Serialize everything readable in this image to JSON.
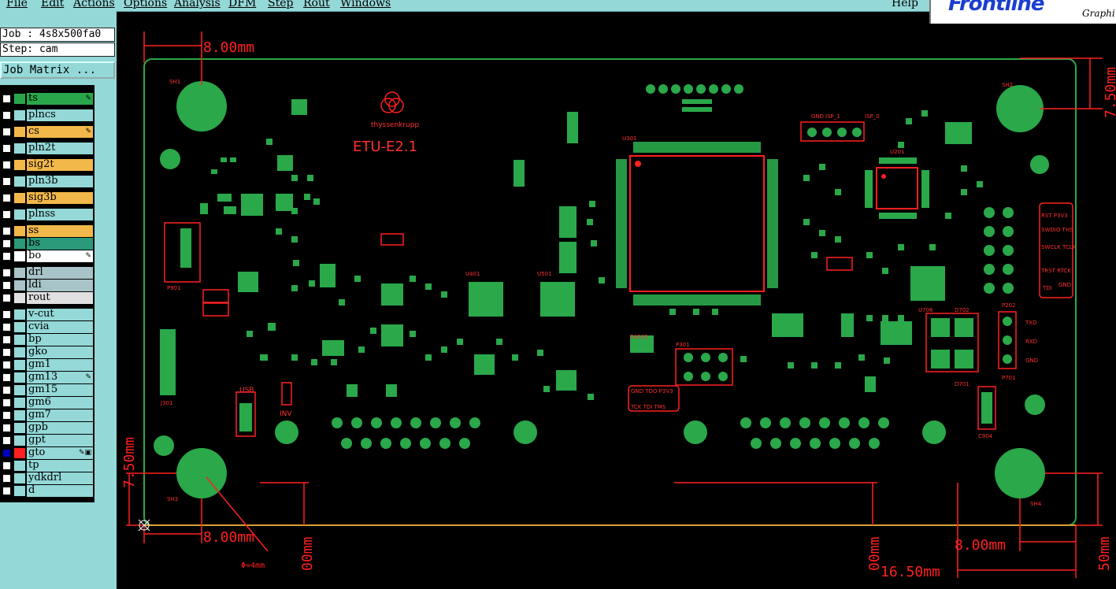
{
  "menu": {
    "file": "File",
    "edit": "Edit",
    "actions": "Actions",
    "options": "Options",
    "analysis": "Analysis",
    "dfm": "DFM",
    "step": "Step",
    "rout": "Rout",
    "windows": "Windows",
    "help": "Help"
  },
  "logo": {
    "brand": "Frontline",
    "sub": "Graphi"
  },
  "job": {
    "label": "Job : 4s8x500fa0",
    "step": "Step: cam",
    "matrix_button": "Job Matrix ..."
  },
  "layers": [
    {
      "name": "ts",
      "color": "#2aa64a",
      "bg": "#2aa64a",
      "mark": "edit"
    },
    {
      "name": "plncs",
      "color": "#94d8d8",
      "bg": "#94d8d8",
      "mark": ""
    },
    {
      "name": "cs",
      "color": "#f2b84a",
      "bg": "#f2b84a",
      "mark": "edit"
    },
    {
      "name": "pln2t",
      "color": "#94d8d8",
      "bg": "#94d8d8",
      "mark": ""
    },
    {
      "name": "sig2t",
      "color": "#f2b84a",
      "bg": "#f2b84a",
      "mark": ""
    },
    {
      "name": "pln3b",
      "color": "#94d8d8",
      "bg": "#94d8d8",
      "mark": ""
    },
    {
      "name": "sig3b",
      "color": "#f2b84a",
      "bg": "#f2b84a",
      "mark": ""
    },
    {
      "name": "plnss",
      "color": "#94d8d8",
      "bg": "#94d8d8",
      "mark": ""
    },
    {
      "name": "ss",
      "color": "#f2b84a",
      "bg": "#f2b84a",
      "mark": ""
    },
    {
      "name": "bs",
      "color": "#2a9a7a",
      "bg": "#2a9a7a",
      "mark": ""
    },
    {
      "name": "bo",
      "color": "#ffffff",
      "bg": "#ffffff",
      "mark": "edit"
    },
    {
      "name": "drl",
      "color": "#a8c4c8",
      "bg": "#a8c4c8",
      "mark": ""
    },
    {
      "name": "ldi",
      "color": "#a8c4c8",
      "bg": "#a8c4c8",
      "mark": ""
    },
    {
      "name": "rout",
      "color": "#e0e0e0",
      "bg": "#e0e0e0",
      "mark": ""
    },
    {
      "name": "v-cut",
      "color": "#94d8d8",
      "bg": "#94d8d8",
      "mark": ""
    },
    {
      "name": "cvia",
      "color": "#94d8d8",
      "bg": "#94d8d8",
      "mark": ""
    },
    {
      "name": "bp",
      "color": "#94d8d8",
      "bg": "#94d8d8",
      "mark": ""
    },
    {
      "name": "gko",
      "color": "#94d8d8",
      "bg": "#94d8d8",
      "mark": ""
    },
    {
      "name": "gm1",
      "color": "#94d8d8",
      "bg": "#94d8d8",
      "mark": ""
    },
    {
      "name": "gm13",
      "color": "#94d8d8",
      "bg": "#94d8d8",
      "mark": "edit"
    },
    {
      "name": "gm15",
      "color": "#94d8d8",
      "bg": "#94d8d8",
      "mark": ""
    },
    {
      "name": "gm6",
      "color": "#94d8d8",
      "bg": "#94d8d8",
      "mark": ""
    },
    {
      "name": "gm7",
      "color": "#94d8d8",
      "bg": "#94d8d8",
      "mark": ""
    },
    {
      "name": "gpb",
      "color": "#94d8d8",
      "bg": "#94d8d8",
      "mark": ""
    },
    {
      "name": "gpt",
      "color": "#94d8d8",
      "bg": "#94d8d8",
      "mark": ""
    },
    {
      "name": "gto",
      "color": "#ff2020",
      "bg": "#94d8d8",
      "mark": "edit-active",
      "active": true
    },
    {
      "name": "tp",
      "color": "#94d8d8",
      "bg": "#94d8d8",
      "mark": ""
    },
    {
      "name": "ydkdrl",
      "color": "#94d8d8",
      "bg": "#94d8d8",
      "mark": ""
    },
    {
      "name": "d",
      "color": "#94d8d8",
      "bg": "#94d8d8",
      "mark": ""
    }
  ],
  "board": {
    "title": "ETU-E2.1",
    "brand": "thyssenkrupp",
    "dims": {
      "top_left": "8.00mm",
      "bottom_left": "8.00mm",
      "left_vertical": "7.50mm",
      "bottom_right": "8.00mm",
      "right_bottom_width": "16.50mm",
      "right_top": "7.50mm",
      "top_right_cut": "7.50mm",
      "hole_dia": "Φ=4mm",
      "mid_v1": "00mm",
      "mid_v2": "00mm",
      "right_v": "50mm"
    },
    "labels": {
      "sh1": "SH1",
      "sh2": "SH2",
      "sh3": "SH3",
      "sh4": "SH4",
      "u301": "U301",
      "p301": "P301",
      "p901": "P901",
      "j301": "J301",
      "usb": "USB",
      "inv": "INV",
      "u401": "U401",
      "u501": "U501",
      "u201": "U201",
      "u706": "U706",
      "p701": "P701",
      "d701": "D701",
      "d702": "D702",
      "c904": "C904",
      "ra503": "RA503",
      "p202": "P202",
      "isp1": "ISP_1",
      "isp0": "ISP_0",
      "gnd": "GND",
      "jtag1": "GND TDO  P3V3",
      "jtag2": "TCK  TDI  TMS",
      "rst_p3v3": "RST P3V3",
      "swdio_ths": "SWDIO THS",
      "swclk_tclk": "SWCLK TCLK",
      "trst_rtck": "TRST RTCK",
      "tdi": "TDI",
      "gnd2": "GND",
      "txd": "TXD",
      "rxd": "RXD",
      "gnd3": "GND"
    }
  }
}
